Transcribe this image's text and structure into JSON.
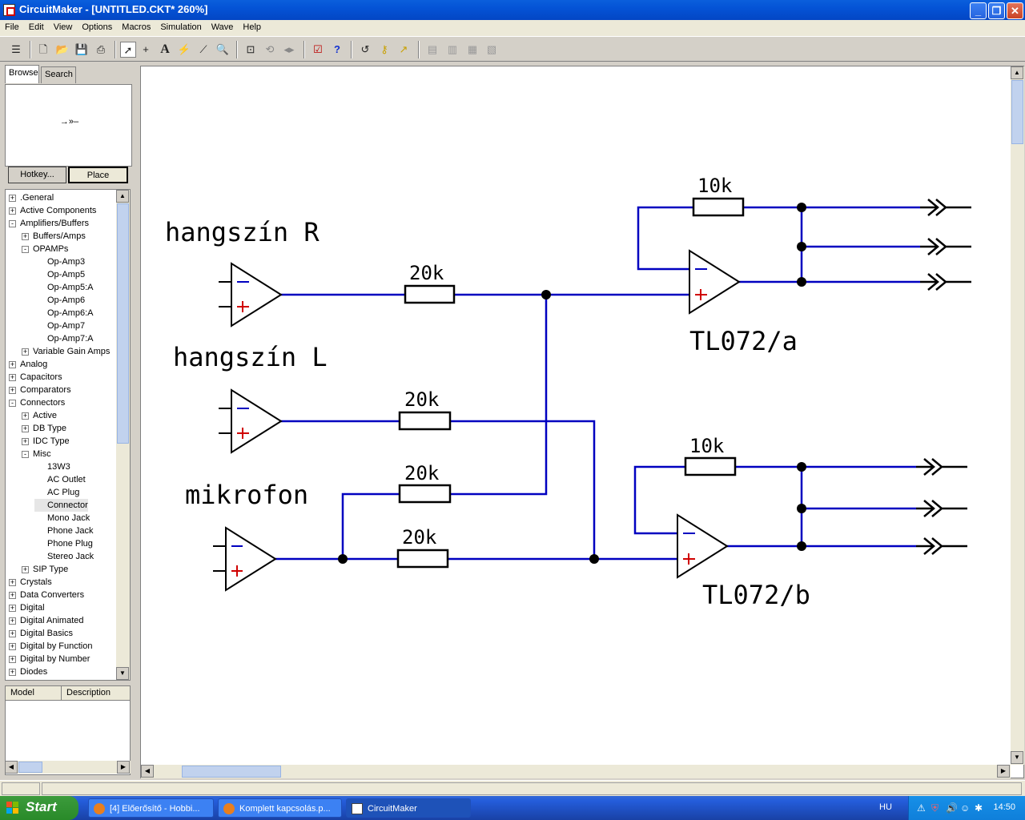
{
  "window": {
    "title": "CircuitMaker - [UNTITLED.CKT* 260%]",
    "buttons": [
      "minimize",
      "restore",
      "close"
    ]
  },
  "menu": [
    "File",
    "Edit",
    "View",
    "Options",
    "Macros",
    "Simulation",
    "Wave",
    "Help"
  ],
  "toolbar": {
    "icons": [
      "toolbar-toggle-icon",
      "new-icon",
      "open-icon",
      "save-icon",
      "print-icon",
      "arrow-tool-icon",
      "wire-tool-icon",
      "text-tool-icon",
      "probe-tool-icon",
      "scope-tool-icon",
      "zoom-tool-icon",
      "fit-icon",
      "rotate-icon",
      "mirror-icon",
      "checklist-icon",
      "help-icon",
      "undo-icon",
      "key-icon",
      "spark-icon",
      "align-1-icon",
      "align-2-icon",
      "align-3-icon",
      "align-4-icon"
    ]
  },
  "browser": {
    "tabs": [
      "Browse",
      "Search"
    ],
    "preview_symbol": "→»–",
    "hotkey_label": "Hotkey...",
    "place_label": "Place",
    "tree": [
      {
        "label": ".General",
        "depth": 0,
        "exp": "+"
      },
      {
        "label": "Active Components",
        "depth": 0,
        "exp": "+"
      },
      {
        "label": "Amplifiers/Buffers",
        "depth": 0,
        "exp": "-"
      },
      {
        "label": "Buffers/Amps",
        "depth": 1,
        "exp": "+"
      },
      {
        "label": "OPAMPs",
        "depth": 1,
        "exp": "-"
      },
      {
        "label": "Op-Amp3",
        "depth": 2,
        "exp": ""
      },
      {
        "label": "Op-Amp5",
        "depth": 2,
        "exp": ""
      },
      {
        "label": "Op-Amp5:A",
        "depth": 2,
        "exp": ""
      },
      {
        "label": "Op-Amp6",
        "depth": 2,
        "exp": ""
      },
      {
        "label": "Op-Amp6:A",
        "depth": 2,
        "exp": ""
      },
      {
        "label": "Op-Amp7",
        "depth": 2,
        "exp": ""
      },
      {
        "label": "Op-Amp7:A",
        "depth": 2,
        "exp": ""
      },
      {
        "label": "Variable Gain Amps",
        "depth": 1,
        "exp": "+"
      },
      {
        "label": "Analog",
        "depth": 0,
        "exp": "+"
      },
      {
        "label": "Capacitors",
        "depth": 0,
        "exp": "+"
      },
      {
        "label": "Comparators",
        "depth": 0,
        "exp": "+"
      },
      {
        "label": "Connectors",
        "depth": 0,
        "exp": "-"
      },
      {
        "label": "Active",
        "depth": 1,
        "exp": "+"
      },
      {
        "label": "DB Type",
        "depth": 1,
        "exp": "+"
      },
      {
        "label": "IDC Type",
        "depth": 1,
        "exp": "+"
      },
      {
        "label": "Misc",
        "depth": 1,
        "exp": "-"
      },
      {
        "label": "13W3",
        "depth": 2,
        "exp": ""
      },
      {
        "label": "AC Outlet",
        "depth": 2,
        "exp": ""
      },
      {
        "label": "AC Plug",
        "depth": 2,
        "exp": ""
      },
      {
        "label": "Connector",
        "depth": 2,
        "exp": "",
        "selected": true
      },
      {
        "label": "Mono Jack",
        "depth": 2,
        "exp": ""
      },
      {
        "label": "Phone Jack",
        "depth": 2,
        "exp": ""
      },
      {
        "label": "Phone Plug",
        "depth": 2,
        "exp": ""
      },
      {
        "label": "Stereo Jack",
        "depth": 2,
        "exp": ""
      },
      {
        "label": "SIP Type",
        "depth": 1,
        "exp": "+"
      },
      {
        "label": "Crystals",
        "depth": 0,
        "exp": "+"
      },
      {
        "label": "Data Converters",
        "depth": 0,
        "exp": "+"
      },
      {
        "label": "Digital",
        "depth": 0,
        "exp": "+"
      },
      {
        "label": "Digital Animated",
        "depth": 0,
        "exp": "+"
      },
      {
        "label": "Digital Basics",
        "depth": 0,
        "exp": "+"
      },
      {
        "label": "Digital by Function",
        "depth": 0,
        "exp": "+"
      },
      {
        "label": "Digital by Number",
        "depth": 0,
        "exp": "+"
      },
      {
        "label": "Diodes",
        "depth": 0,
        "exp": "+"
      }
    ],
    "columns": [
      "Model",
      "Description"
    ]
  },
  "schematic": {
    "wire_color": "#0000c0",
    "labels": {
      "hangszin_r": "hangszín R",
      "hangszin_l": "hangszín L",
      "mikrofon": "mikrofon",
      "tl072a": "TL072/a",
      "tl072b": "TL072/b"
    },
    "resistors": {
      "r1": "20k",
      "r2": "20k",
      "r3": "20k",
      "r4": "20k",
      "rfa": "10k",
      "rfb": "10k"
    }
  },
  "taskbar": {
    "start": "Start",
    "tasks": [
      "[4] Előerősítő - Hobbi...",
      "Komplett kapcsolás.p...",
      "CircuitMaker"
    ],
    "lang": "HU",
    "time": "14:50"
  }
}
